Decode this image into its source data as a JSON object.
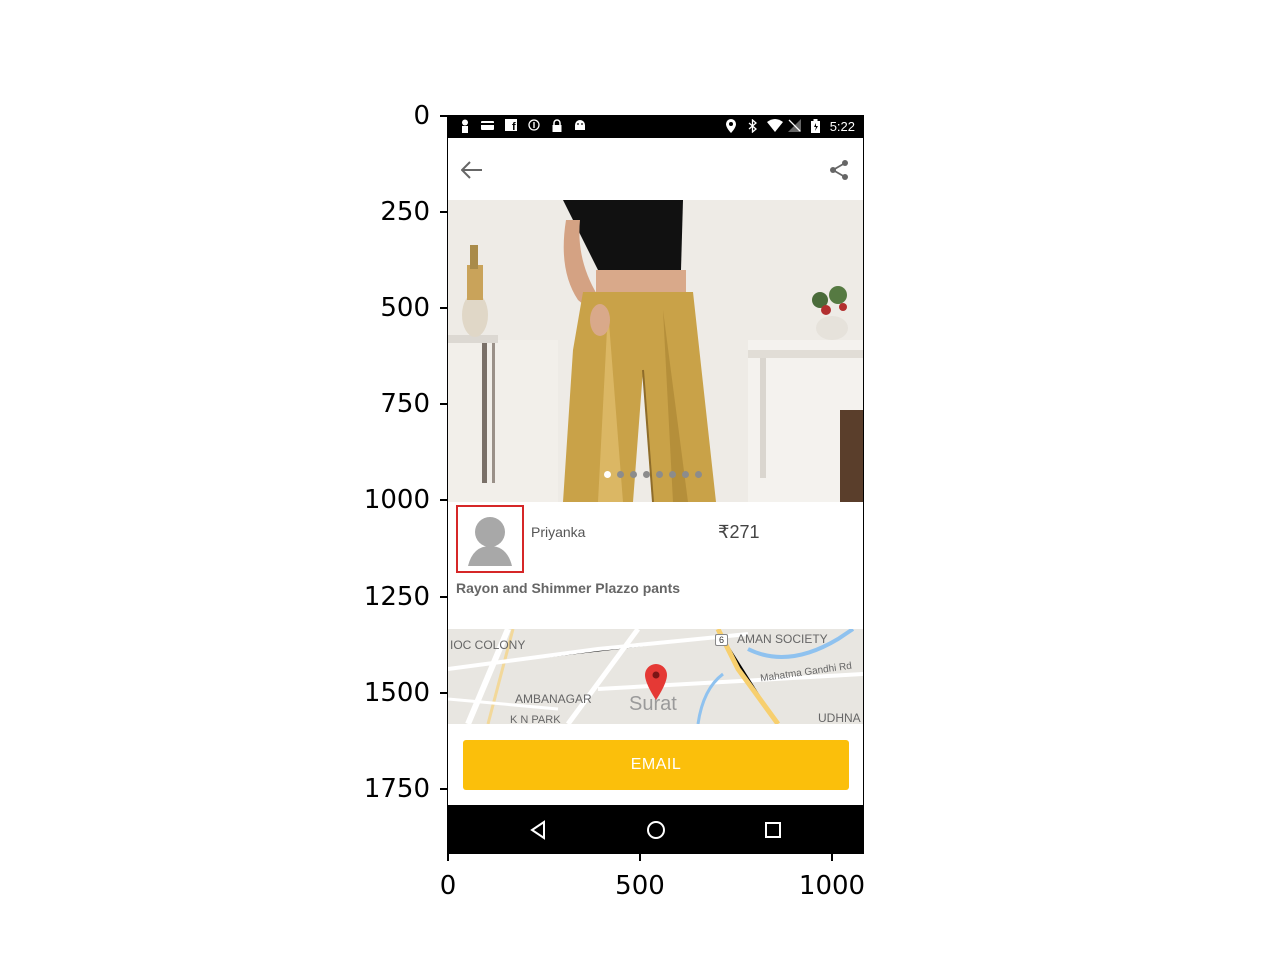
{
  "axes": {
    "y_ticks": [
      "0",
      "250",
      "500",
      "750",
      "1000",
      "1250",
      "1500",
      "1750"
    ],
    "x_ticks": [
      "0",
      "500",
      "1000"
    ]
  },
  "status_bar": {
    "time": "5:22",
    "left_icons": [
      "profile-icon",
      "card-icon",
      "facebook-icon",
      "info-icon",
      "lock-icon",
      "android-icon"
    ],
    "right_icons": [
      "location-icon",
      "bluetooth-icon",
      "wifi-icon",
      "no-signal-icon",
      "battery-icon"
    ]
  },
  "app_bar": {
    "back_icon": "arrow-left-icon",
    "share_icon": "share-icon"
  },
  "gallery": {
    "page_count": 8,
    "active_index": 0
  },
  "listing": {
    "seller_name": "Priyanka",
    "price": "₹271",
    "title": "Rayon and Shimmer Plazzo pants"
  },
  "map": {
    "labels": {
      "ioc_colony": "IOC COLONY",
      "aman_society": "AMAN SOCIETY",
      "road": "Mahatma Gandhi Rd",
      "ambanagar": "AMBANAGAR",
      "kn_park": "K N PARK",
      "city": "Surat",
      "udhna": "UDHNA",
      "route": "6"
    }
  },
  "actions": {
    "email_label": "EMAIL"
  },
  "colors": {
    "accent": "#fbbf0b",
    "highlight_box": "#d62728"
  }
}
